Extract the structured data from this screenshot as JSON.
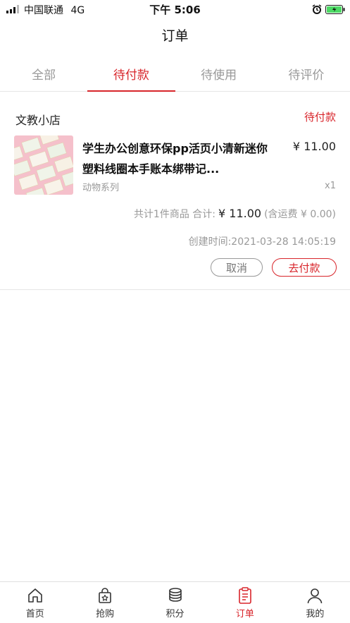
{
  "status_bar": {
    "carrier": "中国联通",
    "network": "4G",
    "time": "下午 5:06"
  },
  "nav": {
    "title": "订单"
  },
  "tabs": [
    {
      "label": "全部",
      "active": false
    },
    {
      "label": "待付款",
      "active": true
    },
    {
      "label": "待使用",
      "active": false
    },
    {
      "label": "待评价",
      "active": false
    }
  ],
  "order": {
    "shop_name": "文教小店",
    "status": "待付款",
    "product": {
      "title": "学生办公创意环保pp活页小清新迷你塑料线圈本手账本绑带记...",
      "price": "¥ 11.00",
      "spec": "动物系列",
      "qty": "x1"
    },
    "summary_prefix": "共计1件商品 合计:",
    "total": "¥ 11.00",
    "shipping_note": "(含运费 ¥ 0.00)",
    "created_time": "创建时间:2021-03-28 14:05:19",
    "cancel_label": "取消",
    "pay_label": "去付款"
  },
  "tabbar": [
    {
      "label": "首页",
      "icon": "home-icon",
      "active": false
    },
    {
      "label": "抢购",
      "icon": "shopping-bag-icon",
      "active": false
    },
    {
      "label": "积分",
      "icon": "coins-stack-icon",
      "active": false
    },
    {
      "label": "订单",
      "icon": "order-list-icon",
      "active": true
    },
    {
      "label": "我的",
      "icon": "user-icon",
      "active": false
    }
  ],
  "colors": {
    "accent": "#d8252b",
    "muted_text": "#999999",
    "divider": "#e6e6e6"
  }
}
